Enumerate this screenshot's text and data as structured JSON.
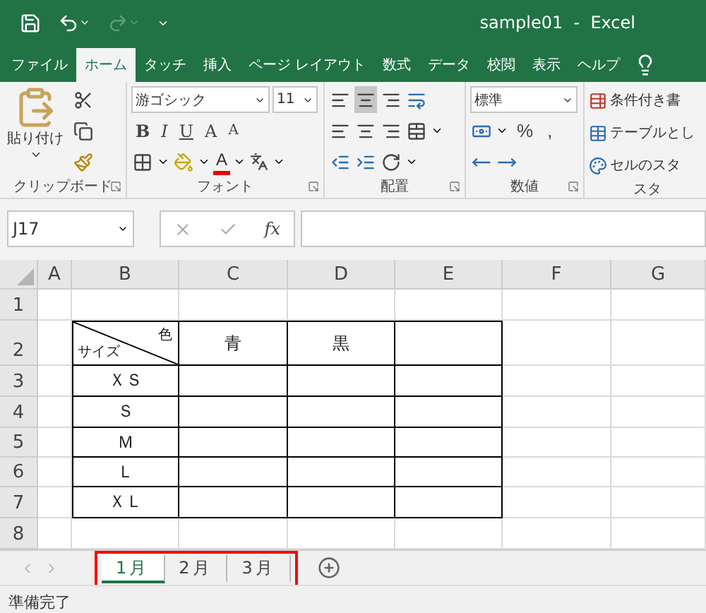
{
  "title_bar": {
    "title": "sample01  -  Excel",
    "redo_disabled": true
  },
  "ribbon_tabs": [
    {
      "label": "ファイル",
      "selected": false
    },
    {
      "label": "ホーム",
      "selected": true
    },
    {
      "label": "タッチ",
      "selected": false
    },
    {
      "label": "挿入",
      "selected": false
    },
    {
      "label": "ページ レイアウト",
      "selected": false
    },
    {
      "label": "数式",
      "selected": false
    },
    {
      "label": "データ",
      "selected": false
    },
    {
      "label": "校閲",
      "selected": false
    },
    {
      "label": "表示",
      "selected": false
    },
    {
      "label": "ヘルプ",
      "selected": false
    }
  ],
  "ribbon": {
    "paste_label": "貼り付け",
    "font_name": "游ゴシック",
    "font_size": "11",
    "font_buttons": [
      {
        "kind": "bold",
        "text": "B"
      },
      {
        "kind": "italic",
        "text": "I"
      },
      {
        "kind": "underline",
        "text": "U"
      },
      {
        "kind": "grow",
        "text": "A"
      },
      {
        "kind": "shrink",
        "text": "A"
      }
    ],
    "font_color_text": "A",
    "vertical_align": [
      {
        "kind": "top",
        "selected": false
      },
      {
        "kind": "middle",
        "selected": true
      },
      {
        "kind": "bottom",
        "selected": false
      }
    ],
    "number_format": "標準",
    "percent": "%",
    "comma": ",",
    "style_buttons": [
      "条件付き書",
      "テーブルとし",
      "セルのスタ"
    ],
    "groups": [
      "クリップボード",
      "フォント",
      "配置",
      "数値",
      "スタ"
    ]
  },
  "formula_bar": {
    "name_box": "J17",
    "fx": "fx"
  },
  "sheet": {
    "columns": [
      "A",
      "B",
      "C",
      "D",
      "E",
      "F",
      "G"
    ],
    "rows": [
      {
        "header": "1",
        "bordered": false,
        "cells": []
      },
      {
        "header": "2",
        "bordered": true,
        "cells": [
          {
            "kind": "empty"
          },
          {
            "kind": "diagonal",
            "top": "色",
            "bottom": "サイズ"
          },
          {
            "kind": "text",
            "text": "青"
          },
          {
            "kind": "text",
            "text": "黒"
          }
        ]
      },
      {
        "header": "3",
        "bordered": true,
        "cells": [
          {
            "kind": "empty"
          },
          {
            "kind": "text",
            "text": "ＸＳ"
          }
        ]
      },
      {
        "header": "4",
        "bordered": true,
        "cells": [
          {
            "kind": "empty"
          },
          {
            "kind": "text",
            "text": "Ｓ"
          }
        ]
      },
      {
        "header": "5",
        "bordered": true,
        "cells": [
          {
            "kind": "empty"
          },
          {
            "kind": "text",
            "text": "Ｍ"
          }
        ]
      },
      {
        "header": "6",
        "bordered": true,
        "cells": [
          {
            "kind": "empty"
          },
          {
            "kind": "text",
            "text": "Ｌ"
          }
        ]
      },
      {
        "header": "7",
        "bordered": true,
        "cells": [
          {
            "kind": "empty"
          },
          {
            "kind": "text",
            "text": "ＸＬ"
          }
        ]
      },
      {
        "header": "8",
        "bordered": false,
        "cells": []
      }
    ]
  },
  "sheet_tabs": [
    {
      "label": "1月",
      "selected": true
    },
    {
      "label": "2月",
      "selected": false
    },
    {
      "label": "3月",
      "selected": false
    }
  ],
  "status_bar": {
    "text": "準備完了"
  }
}
